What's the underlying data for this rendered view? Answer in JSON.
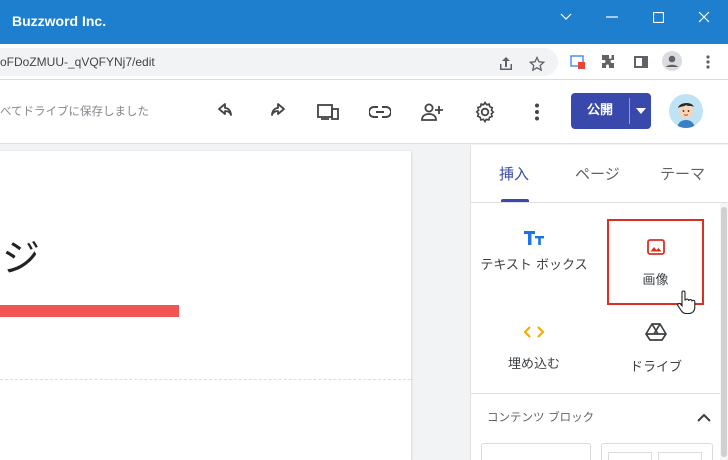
{
  "window": {
    "title": "Buzzword Inc.",
    "minimize_icon": "minimize-icon",
    "maximize_icon": "maximize-icon",
    "close_icon": "close-icon",
    "collapse_icon": "chevron-down-icon"
  },
  "browser": {
    "url": "oFDoZMUU-_qVQFYNj7/edit",
    "icons": [
      "share-icon",
      "star-icon",
      "extension-icon",
      "puzzle-icon",
      "sidepanel-icon",
      "profile-icon",
      "more-icon"
    ]
  },
  "toolbar": {
    "saved_status": "べてドライブに保存しました",
    "icons": [
      "undo-icon",
      "redo-icon",
      "preview-icon",
      "link-icon",
      "add-person-icon",
      "settings-icon",
      "more-vert-icon"
    ],
    "publish_label": "公開"
  },
  "page": {
    "heading": "ジ"
  },
  "panel": {
    "tabs": [
      "挿入",
      "ページ",
      "テーマ"
    ],
    "active_tab": "挿入",
    "tiles": [
      {
        "label": "テキスト ボックス",
        "icon": "text-box-icon"
      },
      {
        "label": "画像",
        "icon": "image-icon",
        "selected": true
      },
      {
        "label": "埋め込む",
        "icon": "embed-icon"
      },
      {
        "label": "ドライブ",
        "icon": "drive-icon"
      }
    ],
    "section_title": "コンテンツ ブロック"
  },
  "colors": {
    "titlebar": "#1f7fcf",
    "accent": "#3949ab",
    "red_bar": "#f25353",
    "selection": "#d93025"
  }
}
